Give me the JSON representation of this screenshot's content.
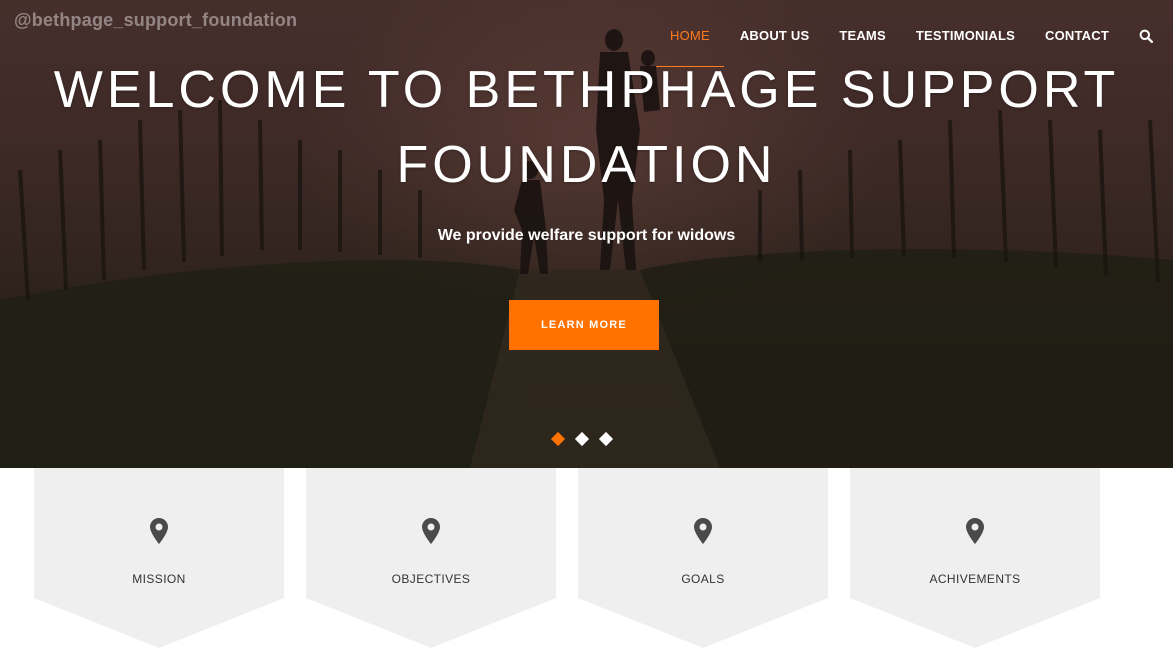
{
  "watermark": "@bethpage_support_foundation",
  "nav": {
    "items": [
      "HOME",
      "ABOUT US",
      "TEAMS",
      "TESTIMONIALS",
      "CONTACT"
    ],
    "active": "HOME",
    "search_icon": "search-icon"
  },
  "hero": {
    "title_line1": "WELCOME TO BETHPHAGE SUPPORT",
    "title_line2": "FOUNDATION",
    "subtitle": "We provide welfare support for widows",
    "cta_label": "LEARN MORE",
    "slides": 3,
    "active_slide": 1
  },
  "cards": [
    {
      "label": "MISSION",
      "icon": "map-pin-icon"
    },
    {
      "label": "OBJECTIVES",
      "icon": "map-pin-icon"
    },
    {
      "label": "GOALS",
      "icon": "map-pin-icon"
    },
    {
      "label": "ACHIVEMENTS",
      "icon": "map-pin-icon"
    }
  ],
  "colors": {
    "accent": "#ff7200",
    "card_bg": "#efefef",
    "text_dark": "#333333"
  }
}
